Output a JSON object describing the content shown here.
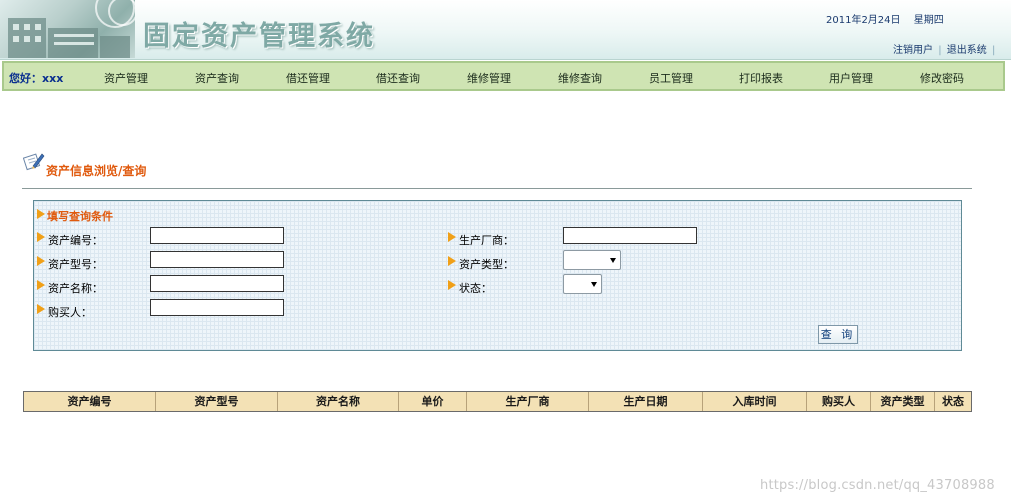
{
  "header": {
    "app_title": "固定资产管理系统",
    "date": "2011年2月24日",
    "weekday": "星期四",
    "logout_user": "注销用户",
    "exit_system": "退出系统",
    "sep1": "|",
    "sep2": "|"
  },
  "nav": {
    "greeting": "您好：xxx",
    "items": [
      "资产管理",
      "资产查询",
      "借还管理",
      "借还查询",
      "维修管理",
      "维修查询",
      "员工管理",
      "打印报表",
      "用户管理",
      "修改密码"
    ]
  },
  "page": {
    "section_title": "资产信息浏览/查询"
  },
  "query": {
    "title": "填写查询条件",
    "fields": {
      "asset_no": {
        "label": "资产编号：",
        "value": ""
      },
      "asset_model": {
        "label": "资产型号：",
        "value": ""
      },
      "asset_name": {
        "label": "资产名称：",
        "value": ""
      },
      "buyer": {
        "label": "购买人：",
        "value": ""
      },
      "manufacturer": {
        "label": "生产厂商：",
        "value": ""
      },
      "asset_type": {
        "label": "资产类型：",
        "value": ""
      },
      "status": {
        "label": "状态：",
        "value": ""
      }
    },
    "submit_label": "查 询"
  },
  "table": {
    "columns": [
      "资产编号",
      "资产型号",
      "资产名称",
      "单价",
      "生产厂商",
      "生产日期",
      "入库时间",
      "购买人",
      "资产类型",
      "状态"
    ],
    "rows": []
  },
  "watermark": "https://blog.csdn.net/qq_43708988",
  "colors": {
    "nav_bg": "#cfe4b3",
    "accent_orange": "#e05a0e",
    "table_header_bg": "#f3e1b5",
    "panel_border": "#5f8a96"
  }
}
